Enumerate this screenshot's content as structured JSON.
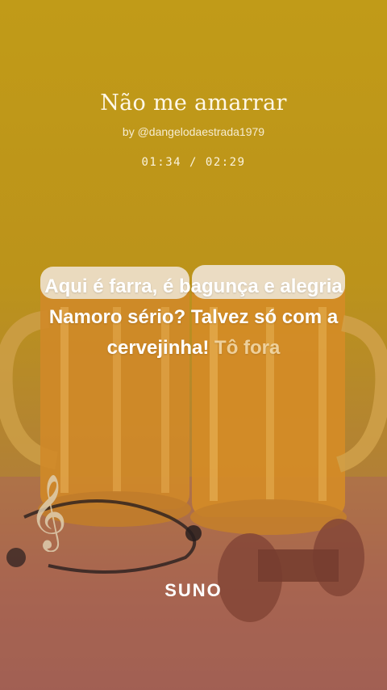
{
  "song": {
    "title": "Não me amarrar",
    "author": "by @dangelodaestrada1979"
  },
  "player": {
    "current_time": "01:34",
    "separator": " / ",
    "total_time": "02:29"
  },
  "lyrics": {
    "active_text": "Aqui é farra, é bagunça e alegria Namoro sério? Talvez só com a cervejinha!",
    "upcoming_text": "Tô fora"
  },
  "brand": {
    "logo_text": "SUNO"
  },
  "colors": {
    "background_top": "#c9a21a",
    "background_bottom": "#9a5a55",
    "text": "#ffffff"
  }
}
